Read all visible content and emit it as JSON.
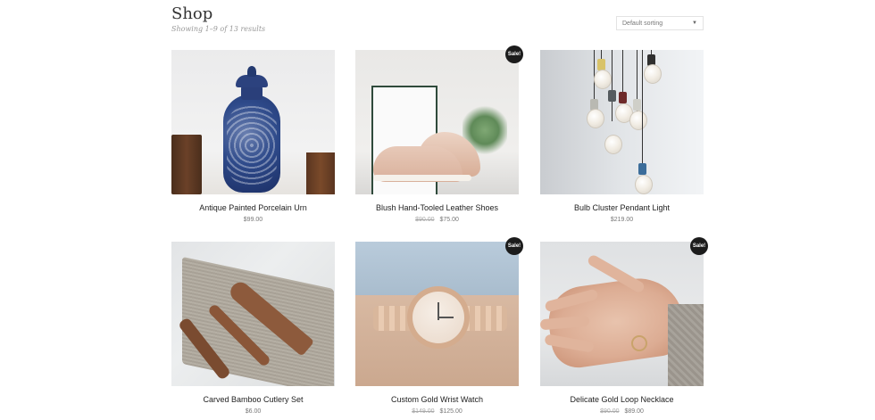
{
  "header": {
    "title": "Shop",
    "result_count": "Showing 1–9 of 13 results"
  },
  "sorting": {
    "selected": "Default sorting"
  },
  "products": [
    {
      "name": "Antique Painted Porcelain Urn",
      "price": "$99.00",
      "regular_price": "",
      "sale": false
    },
    {
      "name": "Blush Hand-Tooled Leather Shoes",
      "price": "$75.00",
      "regular_price": "$90.00",
      "sale": true,
      "badge": "Sale!"
    },
    {
      "name": "Bulb Cluster Pendant Light",
      "price": "$219.00",
      "regular_price": "",
      "sale": false
    },
    {
      "name": "Carved Bamboo Cutlery Set",
      "price": "$6.00",
      "regular_price": "",
      "sale": false
    },
    {
      "name": "Custom Gold Wrist Watch",
      "price": "$125.00",
      "regular_price": "$149.00",
      "sale": true,
      "badge": "Sale!"
    },
    {
      "name": "Delicate Gold Loop Necklace",
      "price": "$89.00",
      "regular_price": "$90.00",
      "sale": true,
      "badge": "Sale!"
    }
  ],
  "colors": {
    "badge_bg": "#1c1c1c",
    "title_text": "#333333",
    "price_text": "#777777"
  }
}
